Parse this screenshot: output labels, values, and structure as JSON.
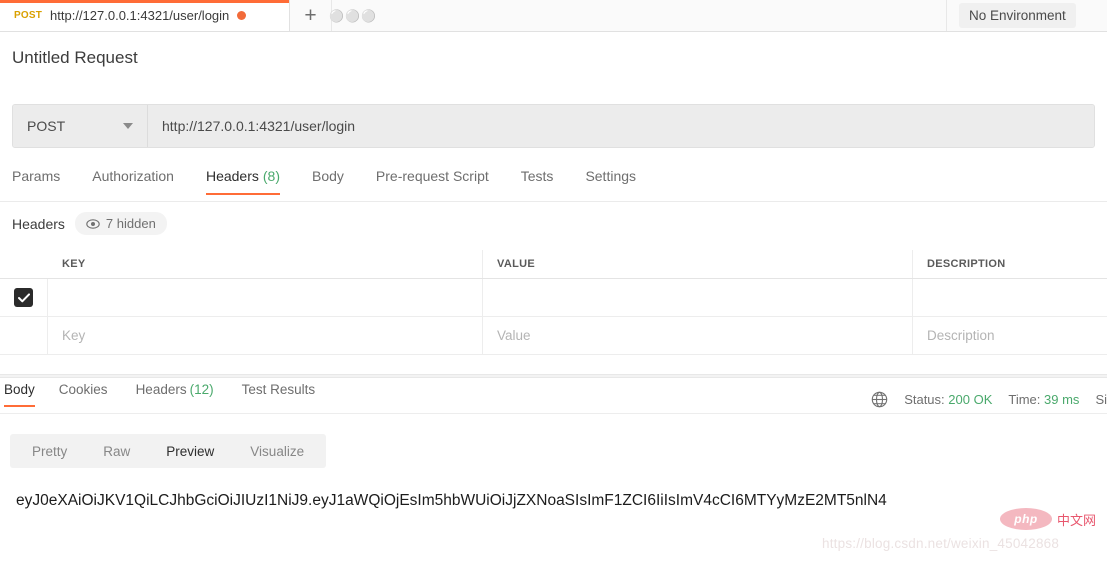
{
  "tabstrip": {
    "request_tab": {
      "method": "POST",
      "url": "http://127.0.0.1:4321/user/login",
      "unsaved": true
    },
    "new_tab_label": "+",
    "more_label": "000",
    "environment": "No Environment"
  },
  "request": {
    "name": "Untitled Request",
    "method": "POST",
    "url": "http://127.0.0.1:4321/user/login",
    "tabs": [
      {
        "label": "Params",
        "count": "",
        "active": false
      },
      {
        "label": "Authorization",
        "count": "",
        "active": false
      },
      {
        "label": "Headers",
        "count": "(8)",
        "active": true
      },
      {
        "label": "Body",
        "count": "",
        "active": false
      },
      {
        "label": "Pre-request Script",
        "count": "",
        "active": false
      },
      {
        "label": "Tests",
        "count": "",
        "active": false
      },
      {
        "label": "Settings",
        "count": "",
        "active": false
      }
    ],
    "headers_section": {
      "label": "Headers",
      "hidden_pill": "7 hidden"
    },
    "table": {
      "columns": [
        "KEY",
        "VALUE",
        "DESCRIPTION"
      ],
      "rows": [
        {
          "checked": true,
          "key": "",
          "value": "",
          "description": ""
        }
      ],
      "placeholders": {
        "key": "Key",
        "value": "Value",
        "description": "Description"
      }
    }
  },
  "response": {
    "tabs": [
      {
        "label": "Body",
        "count": "",
        "active": true
      },
      {
        "label": "Cookies",
        "count": "",
        "active": false
      },
      {
        "label": "Headers",
        "count": "(12)",
        "active": false
      },
      {
        "label": "Test Results",
        "count": "",
        "active": false
      }
    ],
    "meta": {
      "status_label": "Status:",
      "status_value": "200 OK",
      "time_label": "Time:",
      "time_value": "39 ms",
      "size_label": "Si"
    },
    "view_modes": [
      {
        "label": "Pretty",
        "active": false
      },
      {
        "label": "Raw",
        "active": false
      },
      {
        "label": "Preview",
        "active": true
      },
      {
        "label": "Visualize",
        "active": false
      }
    ],
    "body_text": "eyJ0eXAiOiJKV1QiLCJhbGciOiJIUzI1NiJ9.eyJ1aWQiOjEsIm5hbWUiOiJjZXNoaSIsImF1ZCI6IiIsImV4cCI6MTYyMzE2MT5nlN4"
  },
  "watermarks": {
    "php_logo": "php",
    "php_cn": "中文网",
    "csdn_url": "https://blog.csdn.net/weixin_45042868"
  },
  "colors": {
    "accent": "#ff6c37",
    "success": "#4aa96c",
    "method": "#d9a000"
  }
}
